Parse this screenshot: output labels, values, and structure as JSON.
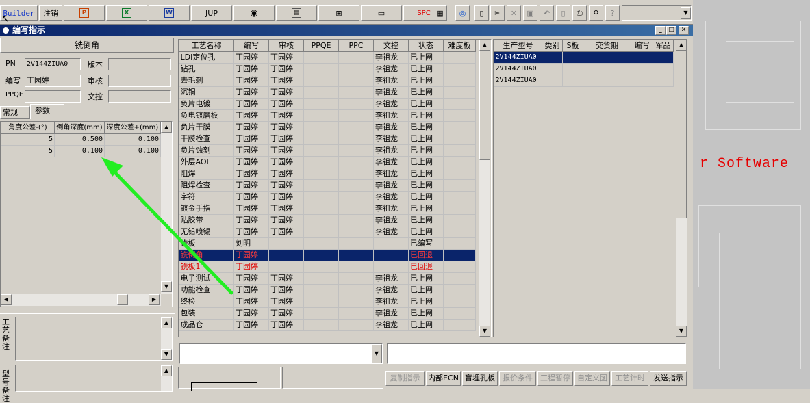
{
  "toolbar": {
    "builder": "Builder",
    "logout": "注销",
    "jup": "JUP",
    "spc": "SPC",
    "icons": [
      "ppt-icon",
      "excel-icon",
      "word-icon",
      "jup-icon",
      "eye-icon",
      "cabinet-icon",
      "network-icon",
      "monitor-icon",
      "spc-icon",
      "calculator-icon",
      "globe-icon",
      "new-icon",
      "cut-icon",
      "delete-icon",
      "save-icon",
      "undo-icon",
      "preview-icon",
      "print-icon",
      "find-icon",
      "help-icon"
    ]
  },
  "window": {
    "title": "编写指示"
  },
  "left": {
    "header": "铣倒角",
    "pn_label": "PN",
    "pn_value": "2V144ZIUA0",
    "version_label": "版本",
    "author_label": "编写",
    "author_value": "丁园婷",
    "review_label": "审核",
    "ppqe_label": "PPQE",
    "doc_label": "文控",
    "tabs": [
      "常规",
      "参数"
    ],
    "param_headers": [
      "角度公差-(°)",
      "倒角深度(mm)",
      "深度公差+(mm)"
    ],
    "param_rows": [
      [
        "5",
        "0.500",
        "0.100"
      ],
      [
        "5",
        "0.100",
        "0.100"
      ]
    ],
    "note1_label": "工艺备注",
    "note2_label": "型号备注"
  },
  "process": {
    "headers": [
      "工艺名称",
      "编写",
      "审核",
      "PPQE",
      "PPC",
      "文控",
      "状态",
      "难度板"
    ],
    "rows": [
      [
        "LDI定位孔",
        "丁园婷",
        "丁园婷",
        "",
        "",
        "李祖龙",
        "已上网",
        ""
      ],
      [
        "钻孔",
        "丁园婷",
        "丁园婷",
        "",
        "",
        "李祖龙",
        "已上网",
        ""
      ],
      [
        "去毛刺",
        "丁园婷",
        "丁园婷",
        "",
        "",
        "李祖龙",
        "已上网",
        ""
      ],
      [
        "沉铜",
        "丁园婷",
        "丁园婷",
        "",
        "",
        "李祖龙",
        "已上网",
        ""
      ],
      [
        "负片电镀",
        "丁园婷",
        "丁园婷",
        "",
        "",
        "李祖龙",
        "已上网",
        ""
      ],
      [
        "负电镀磨板",
        "丁园婷",
        "丁园婷",
        "",
        "",
        "李祖龙",
        "已上网",
        ""
      ],
      [
        "负片干膜",
        "丁园婷",
        "丁园婷",
        "",
        "",
        "李祖龙",
        "已上网",
        ""
      ],
      [
        "干膜检查",
        "丁园婷",
        "丁园婷",
        "",
        "",
        "李祖龙",
        "已上网",
        ""
      ],
      [
        "负片蚀刻",
        "丁园婷",
        "丁园婷",
        "",
        "",
        "李祖龙",
        "已上网",
        ""
      ],
      [
        "外层AOI",
        "丁园婷",
        "丁园婷",
        "",
        "",
        "李祖龙",
        "已上网",
        ""
      ],
      [
        "阻焊",
        "丁园婷",
        "丁园婷",
        "",
        "",
        "李祖龙",
        "已上网",
        ""
      ],
      [
        "阻焊检查",
        "丁园婷",
        "丁园婷",
        "",
        "",
        "李祖龙",
        "已上网",
        ""
      ],
      [
        "字符",
        "丁园婷",
        "丁园婷",
        "",
        "",
        "李祖龙",
        "已上网",
        ""
      ],
      [
        "镀金手指",
        "丁园婷",
        "丁园婷",
        "",
        "",
        "李祖龙",
        "已上网",
        ""
      ],
      [
        "贴胶带",
        "丁园婷",
        "丁园婷",
        "",
        "",
        "李祖龙",
        "已上网",
        ""
      ],
      [
        "无铅喷锡",
        "丁园婷",
        "丁园婷",
        "",
        "",
        "李祖龙",
        "已上网",
        ""
      ],
      [
        "铣板",
        "刘明",
        "",
        "",
        "",
        "",
        "已编写",
        ""
      ],
      [
        "铣倒角",
        "丁园婷",
        "",
        "",
        "",
        "",
        "已回退",
        ""
      ],
      [
        "铣板1",
        "丁园婷",
        "",
        "",
        "",
        "",
        "已回退",
        ""
      ],
      [
        "电子测试",
        "丁园婷",
        "丁园婷",
        "",
        "",
        "李祖龙",
        "已上网",
        ""
      ],
      [
        "功能检查",
        "丁园婷",
        "丁园婷",
        "",
        "",
        "李祖龙",
        "已上网",
        ""
      ],
      [
        "终检",
        "丁园婷",
        "丁园婷",
        "",
        "",
        "李祖龙",
        "已上网",
        ""
      ],
      [
        "包装",
        "丁园婷",
        "丁园婷",
        "",
        "",
        "李祖龙",
        "已上网",
        ""
      ],
      [
        "成品仓",
        "丁园婷",
        "丁园婷",
        "",
        "",
        "李祖龙",
        "已上网",
        ""
      ]
    ]
  },
  "models": {
    "headers": [
      "生产型号",
      "类别",
      "S板",
      "交货期",
      "编写",
      "军品"
    ],
    "rows": [
      [
        "2V144ZIUA0"
      ],
      [
        "2V144ZIUA0"
      ],
      [
        "2V144ZIUA0"
      ]
    ]
  },
  "buttons": [
    "复制指示",
    "内部ECN",
    "盲埋孔板",
    "报价条件",
    "工程暂停",
    "自定义图",
    "工艺计时",
    "发送指示"
  ],
  "background": {
    "text": "r Software"
  },
  "colors": {
    "titlebar": "#0a246a",
    "selected_row": "#0a246a",
    "rollback_text": "#e00000",
    "arrow": "#22ee22"
  }
}
